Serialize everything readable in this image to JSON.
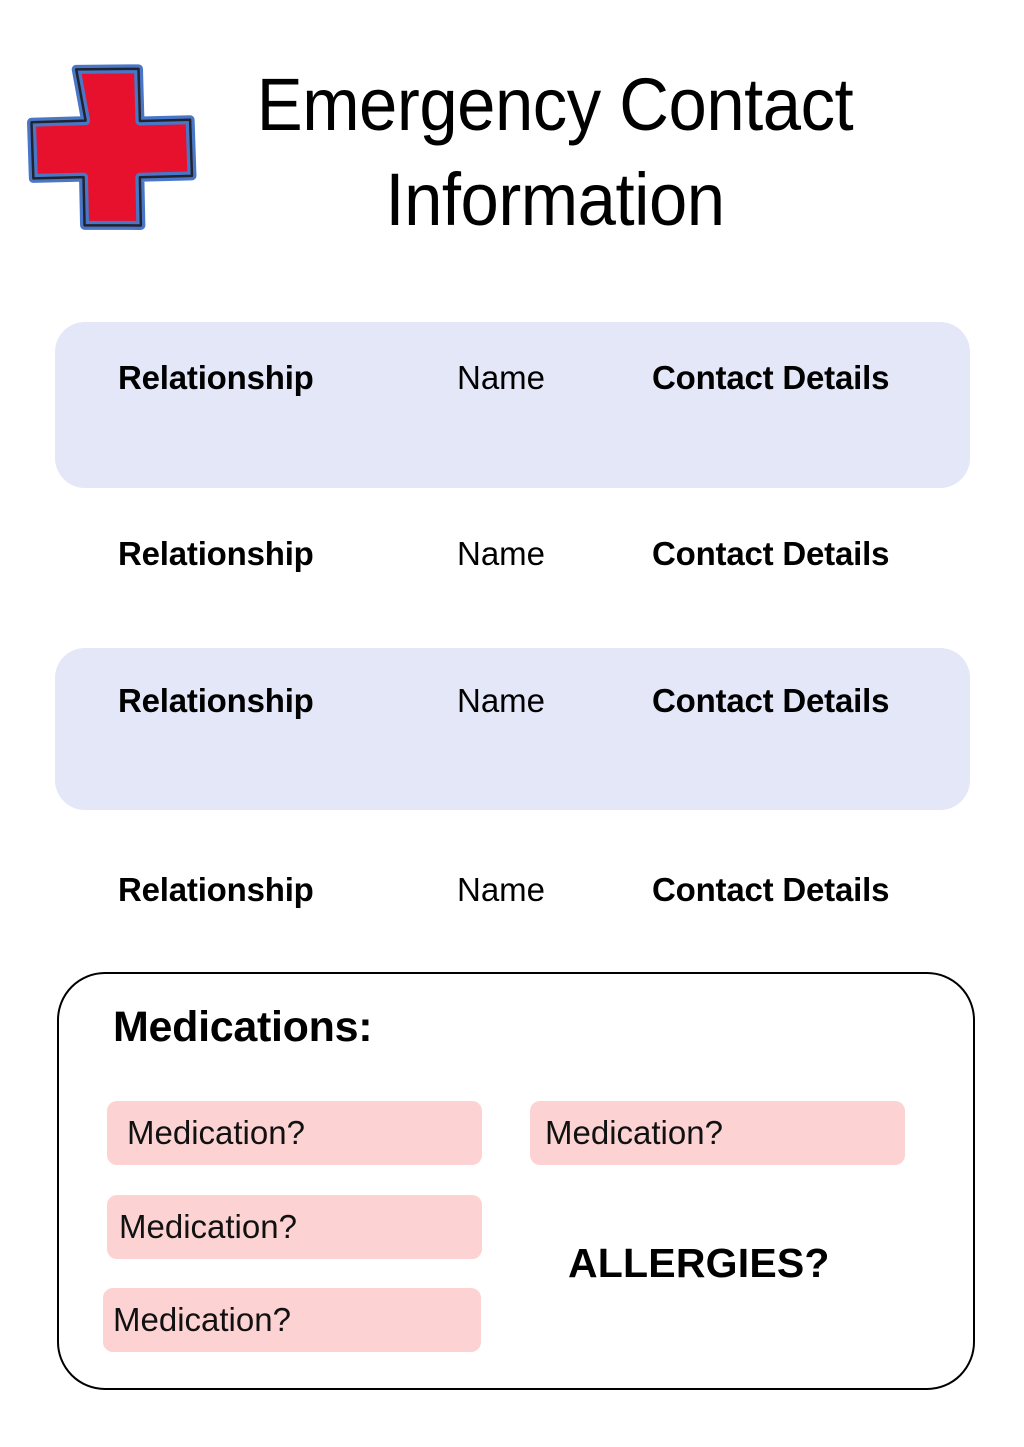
{
  "header": {
    "title": "Emergency Contact\nInformation",
    "icon": "red-cross-icon",
    "icon_colors": {
      "fill": "#E8112D",
      "outline": "#4A76C8",
      "edge": "#1A1A1A"
    }
  },
  "contacts": {
    "columns": [
      "Relationship",
      "Name",
      "Contact Details"
    ],
    "shaded_color": "#E3E7F7",
    "rows": [
      {
        "relationship": "Relationship",
        "name": "Name",
        "contact": "Contact Details",
        "shaded": true
      },
      {
        "relationship": "Relationship",
        "name": "Name",
        "contact": "Contact Details",
        "shaded": false
      },
      {
        "relationship": "Relationship",
        "name": "Name",
        "contact": "Contact Details",
        "shaded": true
      },
      {
        "relationship": "Relationship",
        "name": "Name",
        "contact": "Contact Details",
        "shaded": false
      }
    ]
  },
  "medications": {
    "heading": "Medications:",
    "pill_color": "#FCD2D2",
    "items": [
      {
        "label": "Medication?"
      },
      {
        "label": "Medication?"
      },
      {
        "label": "Medication?"
      },
      {
        "label": "Medication?"
      }
    ],
    "allergies_label": "ALLERGIES?"
  }
}
